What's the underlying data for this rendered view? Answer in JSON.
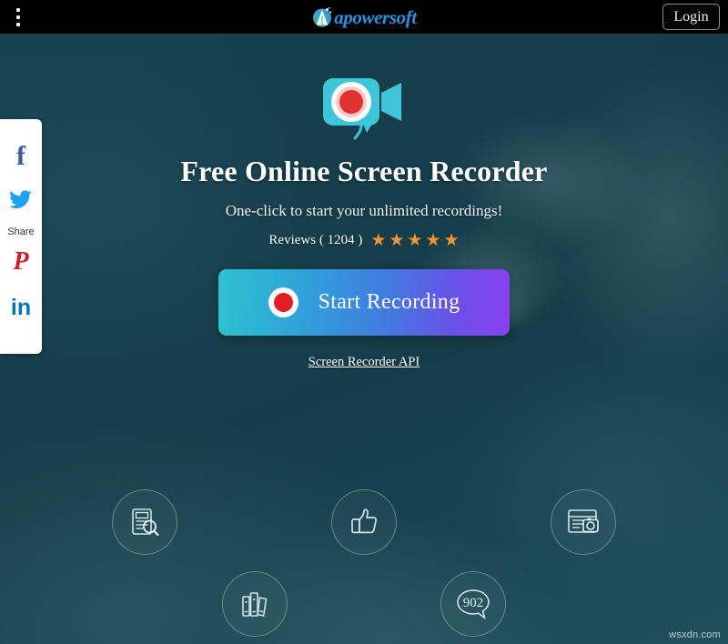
{
  "topbar": {
    "menu_icon": "kebab-menu-icon",
    "logo_text": "apowersoft",
    "logo_icon": "apowersoft-logo-icon",
    "login_label": "Login"
  },
  "share_rail": {
    "label": "Share",
    "items": [
      {
        "name": "facebook",
        "glyph": "f",
        "color": "#3b5998"
      },
      {
        "name": "twitter",
        "glyph": "twitter-bird-icon",
        "color": "#1da1f2"
      },
      {
        "name": "pinterest",
        "glyph": "P",
        "color": "#cb2027"
      },
      {
        "name": "linkedin",
        "glyph": "in",
        "color": "#0077b5"
      }
    ]
  },
  "hero": {
    "camera_icon": "video-camera-record-icon",
    "title": "Free Online Screen Recorder",
    "subtitle": "One-click to start your unlimited recordings!",
    "reviews_label": "Reviews ( 1204 )",
    "star_glyph": "★",
    "star_count": 5,
    "star_color": "#f59331",
    "button_label": "Start Recording",
    "button_icon": "record-dot-icon",
    "button_gradient_from": "#2ec2cf",
    "button_gradient_to": "#8a3ff0",
    "api_link_label": "Screen Recorder API"
  },
  "features": [
    {
      "name": "document-search-icon",
      "badge": ""
    },
    {
      "name": "thumbs-up-icon",
      "badge": ""
    },
    {
      "name": "window-camera-screenshot-icon",
      "badge": ""
    },
    {
      "name": "books-library-icon",
      "badge": ""
    },
    {
      "name": "speech-bubble-count-icon",
      "badge": "902"
    }
  ],
  "watermark": "wsxdn.com"
}
